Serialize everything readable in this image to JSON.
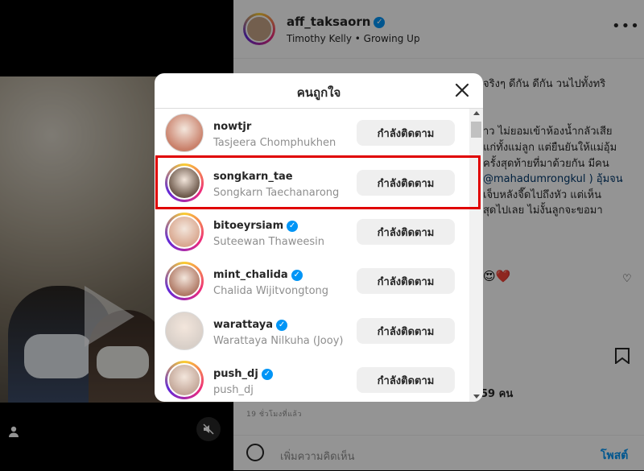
{
  "post": {
    "username": "aff_taksaorn",
    "subtitle": "Timothy Kelly • Growing Up",
    "caption_lines": [
      "จริงๆ ดีกัน ดีกัน วนไปทั้งทริ",
      "าว ไม่ยอมเข้าห้องน้ำกลัวเสีย",
      "แก่ทั้งแม่ลูก แต่ยืนยันให้แม่อุ้ม",
      "ครั้งสุดท้ายที่มาด้วยกัน มีคน",
      "@mahadumrongkul ) อุ้มจน",
      "เจ็บหลังจี๊ดไปถึงหัว แต่เห็น",
      "สุดไปเลย ไม่งั้นลูกจะขอมา"
    ],
    "likes": "59 คน",
    "time_ago": "19 ชั่วโมงที่แล้ว",
    "comment_placeholder": "เพิ่มความคิดเห็น",
    "post_button": "โพสต์"
  },
  "modal": {
    "title": "คนถูกใจ",
    "follow_label": "กำลังติดตาม",
    "users": [
      {
        "username": "nowtjr",
        "full_name": "Tasjeera Chomphukhen",
        "verified": false,
        "ring": false,
        "avatar_color": "#c9806a"
      },
      {
        "username": "songkarn_tae",
        "full_name": "Songkarn Taechanarong",
        "verified": false,
        "ring": true,
        "avatar_color": "#6e5a4c"
      },
      {
        "username": "bitoeyrsiam",
        "full_name": "Suteewan Thaweesin",
        "verified": true,
        "ring": true,
        "avatar_color": "#d9a890"
      },
      {
        "username": "mint_chalida",
        "full_name": "Chalida Wijitvongtong",
        "verified": true,
        "ring": true,
        "avatar_color": "#b07a66"
      },
      {
        "username": "warattaya",
        "full_name": "Warattaya Nilkuha (Jooy)",
        "verified": true,
        "ring": false,
        "avatar_color": "#d8cfc8"
      },
      {
        "username": "push_dj",
        "full_name": "push_dj",
        "verified": true,
        "ring": true,
        "avatar_color": "#c4a89a"
      }
    ]
  },
  "highlight_color": "#e00000"
}
